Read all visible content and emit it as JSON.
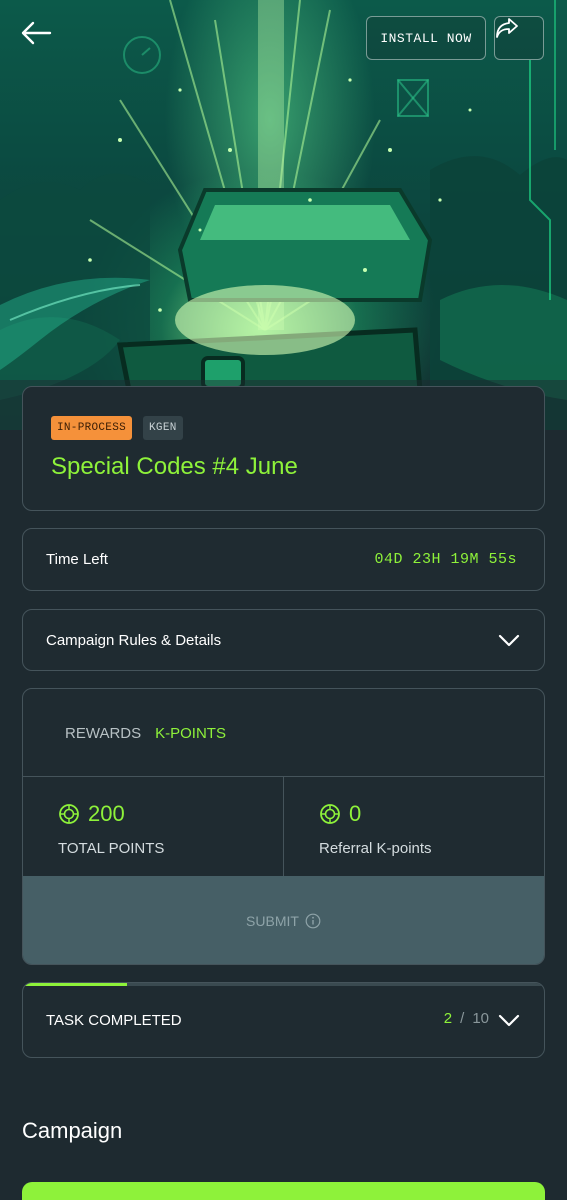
{
  "header": {
    "install_label": "INSTALL NOW"
  },
  "campaign": {
    "status_badge": "IN-PROCESS",
    "brand_badge": "KGEN",
    "title": "Special Codes #4 June"
  },
  "timer": {
    "label": "Time Left",
    "value": "04D 23H 19M 55s"
  },
  "rules": {
    "label": "Campaign Rules & Details"
  },
  "rewards": {
    "label": "REWARDS",
    "type": "K-POINTS",
    "total_points_value": "200",
    "total_points_label": "TOTAL POINTS",
    "referral_value": "0",
    "referral_label": "Referral K-points",
    "submit_label": "SUBMIT"
  },
  "tasks": {
    "label": "TASK COMPLETED",
    "completed": "2",
    "separator": "/",
    "total": "10",
    "progress_fraction": 0.2
  },
  "section": {
    "title": "Campaign"
  },
  "icons": {
    "back": "arrow-left-icon",
    "share": "share-icon",
    "chevron": "chevron-down-icon",
    "points": "points-coin-icon",
    "info": "info-icon",
    "hero": "treasure-chest-illustration"
  },
  "colors": {
    "accent": "#8ef23a",
    "status_badge_bg": "#f5913a",
    "background": "#1e2a30",
    "card_border": "#45545b",
    "submit_bg": "#465f66"
  }
}
